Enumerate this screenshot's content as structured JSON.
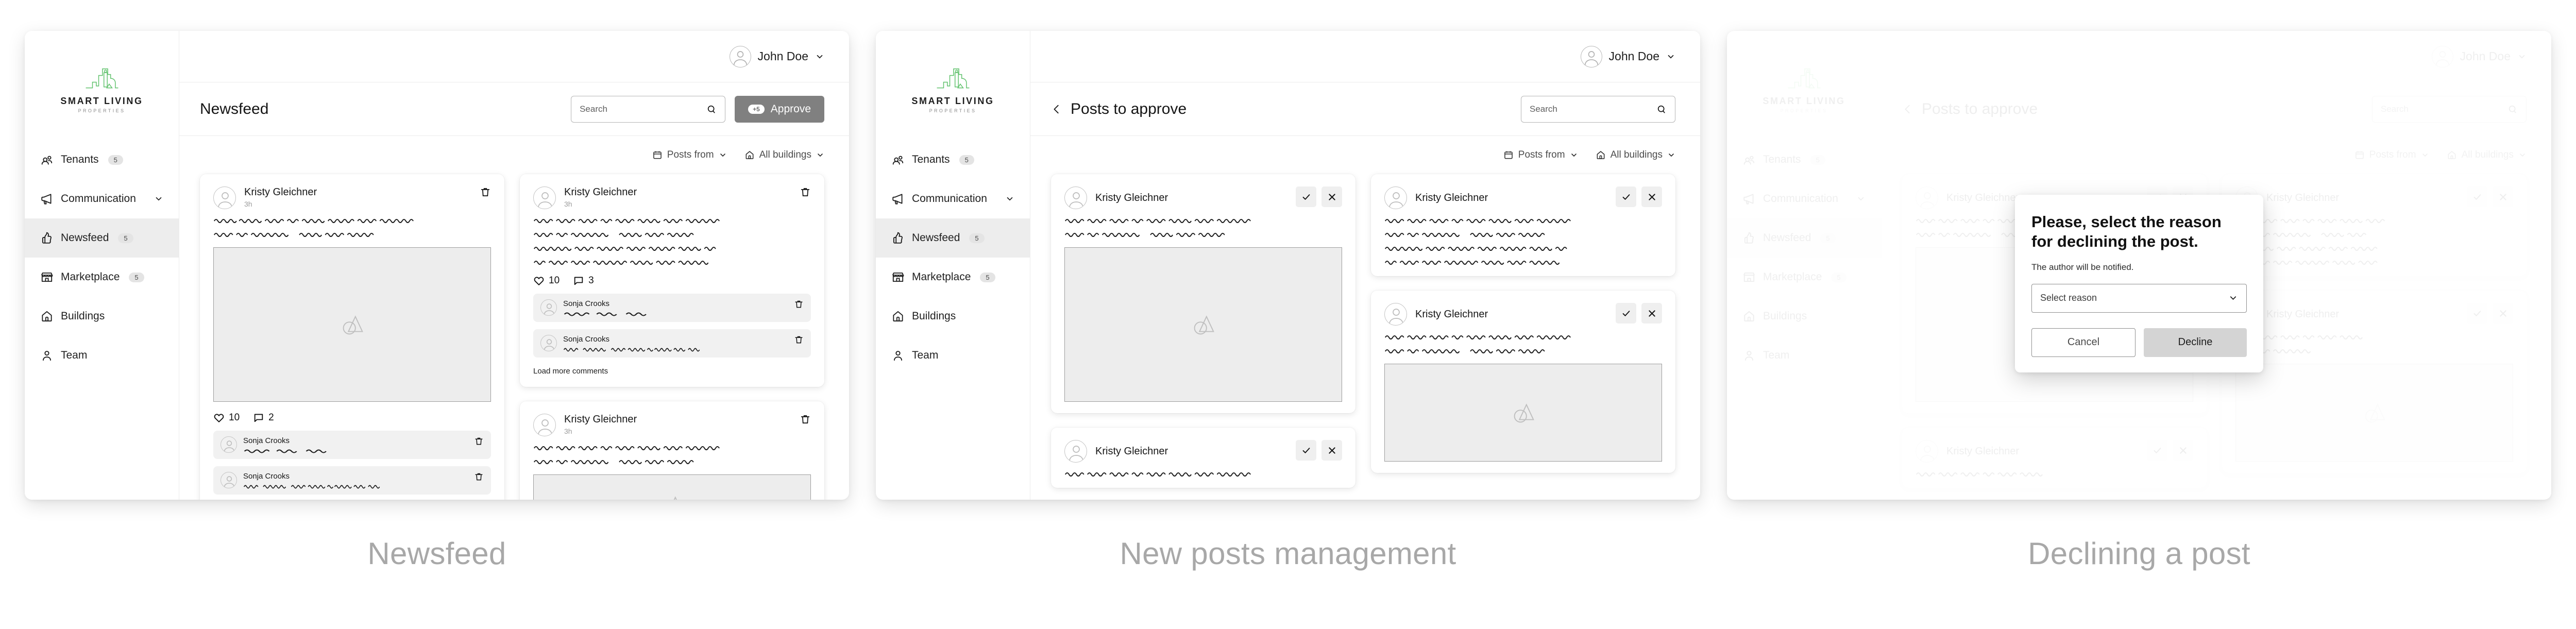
{
  "brand": {
    "name": "SMART LIVING",
    "tagline": "PROPERTIES",
    "logo_color": "#5fc16b"
  },
  "sidebar": {
    "items": [
      {
        "label": "Tenants",
        "badge": "5",
        "icon": "tenants-icon",
        "active": false,
        "caret": false
      },
      {
        "label": "Communication",
        "badge": "",
        "icon": "megaphone-icon",
        "active": false,
        "caret": true
      },
      {
        "label": "Newsfeed",
        "badge": "5",
        "icon": "thumbs-up-icon",
        "active": true,
        "caret": false
      },
      {
        "label": "Marketplace",
        "badge": "5",
        "icon": "storefront-icon",
        "active": false,
        "caret": false
      },
      {
        "label": "Buildings",
        "badge": "",
        "icon": "house-icon",
        "active": false,
        "caret": false
      },
      {
        "label": "Team",
        "badge": "",
        "icon": "person-icon",
        "active": false,
        "caret": false
      }
    ]
  },
  "topbar": {
    "user_name": "John Doe",
    "avatar": "user-avatar-icon",
    "caret": "chevron-down-icon"
  },
  "panels": [
    {
      "caption": "Newsfeed",
      "page_title": "Newsfeed",
      "has_back": false,
      "search_placeholder": "Search",
      "search_value": "",
      "approve_label": "Approve",
      "approve_count": "+5",
      "show_approve": true
    },
    {
      "caption": "New posts management",
      "page_title": "Posts to approve",
      "has_back": true,
      "search_placeholder": "Search",
      "search_value": "",
      "approve_label": "Approve",
      "approve_count": "+5",
      "show_approve": false
    },
    {
      "caption": "Declining a post",
      "page_title": "Posts to approve",
      "has_back": true,
      "search_placeholder": "Search",
      "search_value": "",
      "approve_label": "Approve",
      "approve_count": "+5",
      "show_approve": false
    }
  ],
  "filters": {
    "posts_from": {
      "label": "Posts from",
      "icon": "calendar-icon",
      "caret": "chevron-down-icon"
    },
    "buildings": {
      "label": "All buildings",
      "icon": "house-icon",
      "caret": "chevron-down-icon"
    }
  },
  "post": {
    "author": "Kristy  Gleichner",
    "time": "3h",
    "commenter": "Sonja Crooks",
    "load_more": "Load more comments"
  },
  "newsfeed": {
    "left_card": {
      "likes": "10",
      "comments": "2"
    },
    "right_card": {
      "likes": "10",
      "comments": "3"
    }
  },
  "modal": {
    "title": "Please, select the reason for declining the post.",
    "subtitle": "The author will be notified.",
    "select_value": "Select reason",
    "cancel_label": "Cancel",
    "decline_label": "Decline"
  }
}
